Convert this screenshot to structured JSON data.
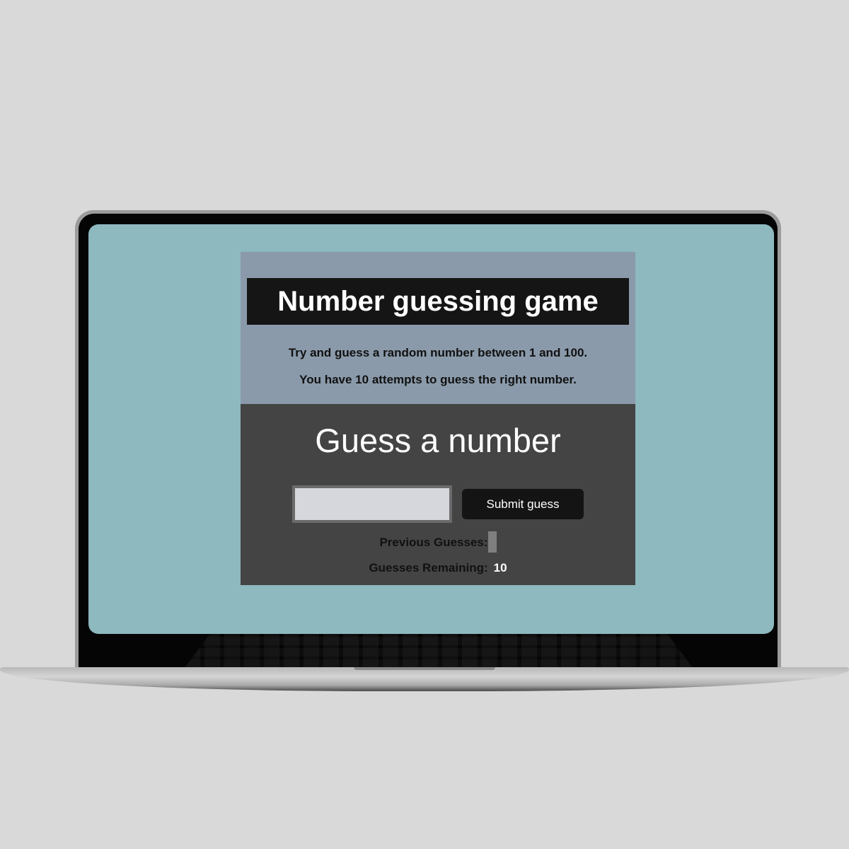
{
  "page": {
    "title": "Number guessing game",
    "intro_line_1": "Try and guess a random number between 1 and 100.",
    "intro_line_2": "You have 10 attempts to guess the right number."
  },
  "form": {
    "heading": "Guess a number",
    "input_value": "",
    "submit_label": "Submit guess"
  },
  "stats": {
    "previous_label": "Previous Guesses:",
    "previous_value": "",
    "remaining_label": "Guesses Remaining:",
    "remaining_value": "10"
  },
  "colors": {
    "screen_background": "#8db9bf",
    "intro_background": "#8a9aaa",
    "title_background": "#151515",
    "play_background": "#444444",
    "input_background": "#d6d7dc",
    "button_background": "#141414"
  }
}
